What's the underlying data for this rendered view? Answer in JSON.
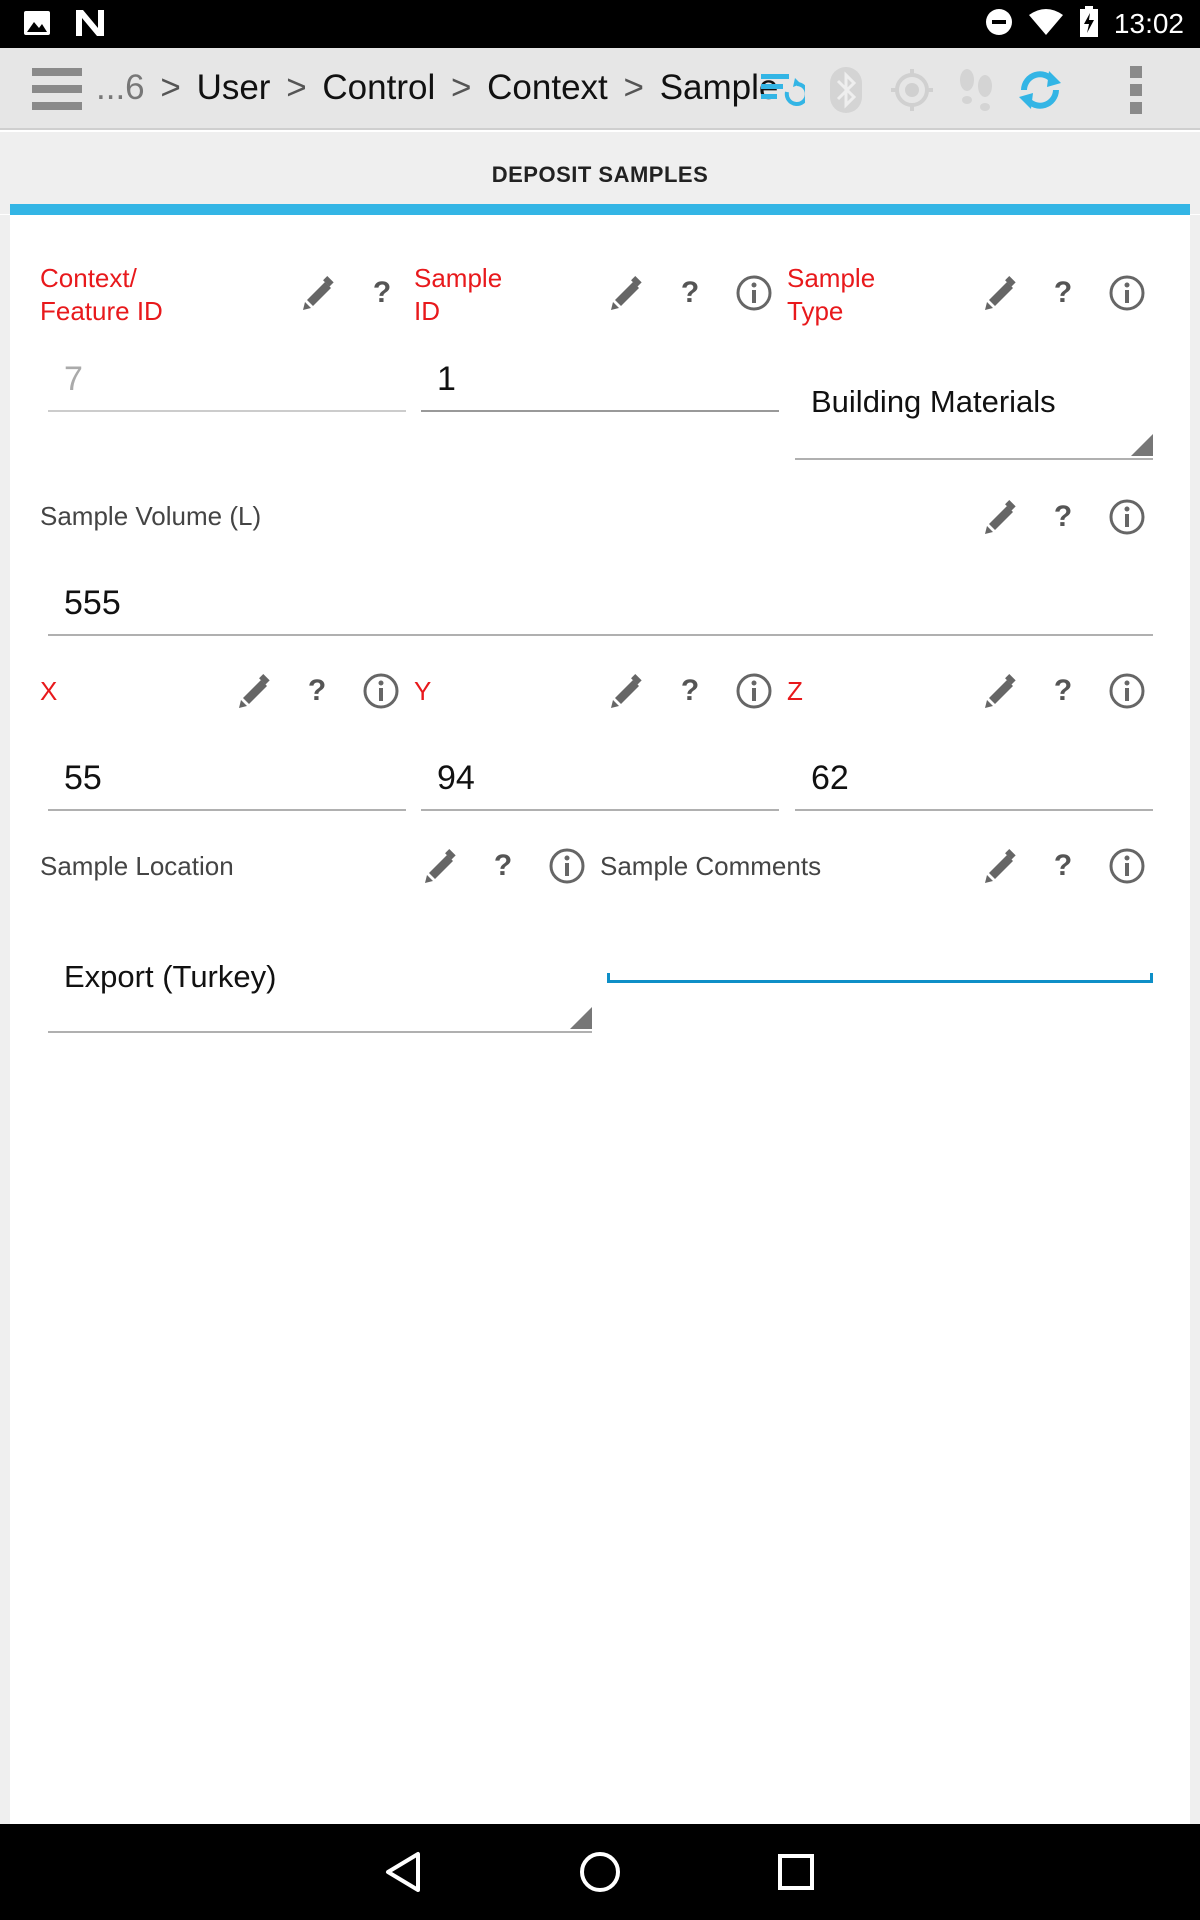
{
  "status_bar": {
    "time": "13:02"
  },
  "action_bar": {
    "breadcrumb_ellipsis": "...6",
    "breadcrumb": [
      "User",
      "Control",
      "Context",
      "Sample"
    ],
    "separator": ">"
  },
  "section": {
    "title": "DEPOSIT SAMPLES"
  },
  "fields": {
    "context_id": {
      "label_line1": "Context/",
      "label_line2": "Feature ID",
      "value": "7"
    },
    "sample_id": {
      "label_line1": "Sample",
      "label_line2": "ID",
      "value": "1"
    },
    "sample_type": {
      "label_line1": "Sample",
      "label_line2": "Type",
      "value": "Building Materials"
    },
    "sample_volume": {
      "label": "Sample Volume (L)",
      "value": "555"
    },
    "x": {
      "label": "X",
      "value": "55"
    },
    "y": {
      "label": "Y",
      "value": "94"
    },
    "z": {
      "label": "Z",
      "value": "62"
    },
    "sample_location": {
      "label": "Sample Location",
      "value": "Export (Turkey)"
    },
    "sample_comments": {
      "label": "Sample Comments",
      "value": ""
    }
  },
  "icons": {
    "help_glyph": "?",
    "accent": "#33b5e5",
    "required_label_color": "#e8191c"
  }
}
